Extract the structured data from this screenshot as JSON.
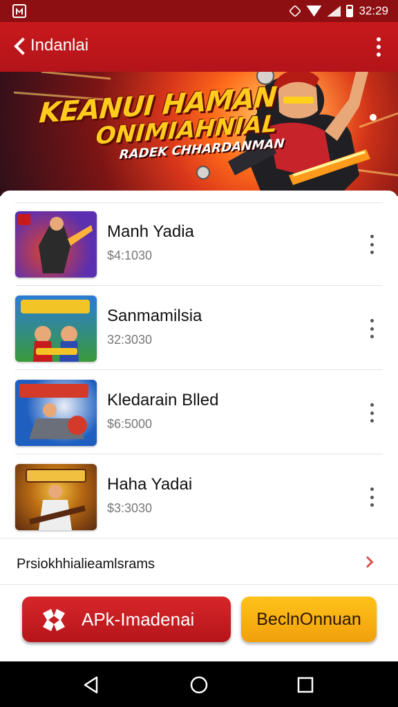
{
  "status_bar": {
    "time": "32:29",
    "icons": [
      "app-notification-icon",
      "mute-icon",
      "wifi-icon",
      "signal-icon",
      "battery-icon"
    ]
  },
  "app_bar": {
    "title": "Indanlai",
    "back_icon": "chevron-left-icon",
    "menu_icon": "overflow-menu-icon"
  },
  "banner": {
    "line1": "KEANUI HAMAN",
    "line2": "ONIMIAHNIAL",
    "line3": "RADEK CHHARDANMAN"
  },
  "items": [
    {
      "name": "Manh Yadia",
      "price": "$4:1030",
      "colors": [
        "#5b2fb0",
        "#e0432c",
        "#ffb33a"
      ]
    },
    {
      "name": "Sanmamilsia",
      "price": "32:3030",
      "colors": [
        "#2b7bd8",
        "#f3c425",
        "#3a9a3a"
      ]
    },
    {
      "name": "Kledarain Blled",
      "price": "$6:5000",
      "colors": [
        "#1f5fc0",
        "#d43a2a",
        "#e9eef8"
      ]
    },
    {
      "name": "Haha Yadai",
      "price": "$3:3030",
      "colors": [
        "#b86a12",
        "#5a2a10",
        "#f2c040"
      ]
    }
  ],
  "more_link": {
    "label": "Prsiokhhialieamlsrams",
    "chevron_icon": "chevron-right-icon"
  },
  "actions": {
    "primary_label": "APk-Imadenai",
    "primary_icon": "apk-logo-icon",
    "secondary_label": "BeclnOnnuan",
    "primary_color": "#c81d22",
    "secondary_color": "#f6b01a"
  },
  "nav_bar": {
    "back_icon": "nav-back-icon",
    "home_icon": "nav-home-icon",
    "recents_icon": "nav-recents-icon"
  }
}
